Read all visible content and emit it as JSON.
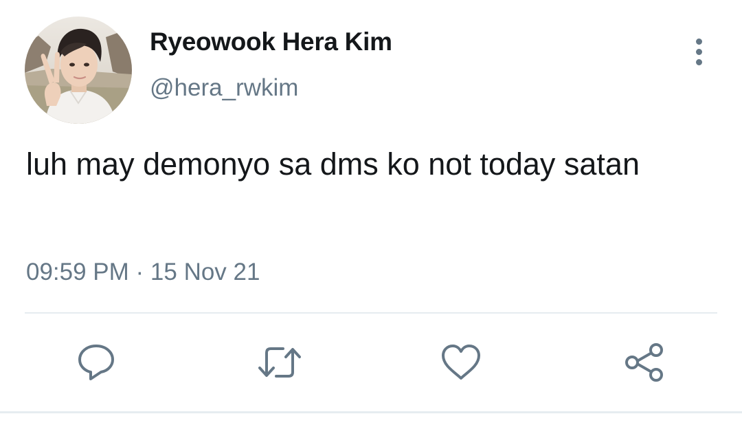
{
  "user": {
    "display_name": "Ryeowook Hera Kim",
    "handle": "@hera_rwkim",
    "avatar_icon": "profile-photo"
  },
  "tweet": {
    "text": "luh may demonyo sa dms ko not today satan",
    "timestamp": "09:59 PM · 15 Nov 21"
  },
  "actions": [
    {
      "name": "reply",
      "icon": "speech-bubble"
    },
    {
      "name": "retweet",
      "icon": "retweet-arrows"
    },
    {
      "name": "like",
      "icon": "heart"
    },
    {
      "name": "share",
      "icon": "share-nodes"
    }
  ],
  "menu_icon": "vertical-ellipsis",
  "colors": {
    "primary_text": "#14171a",
    "secondary_text": "#657786",
    "divider": "#e6ecf0",
    "background": "#ffffff"
  }
}
